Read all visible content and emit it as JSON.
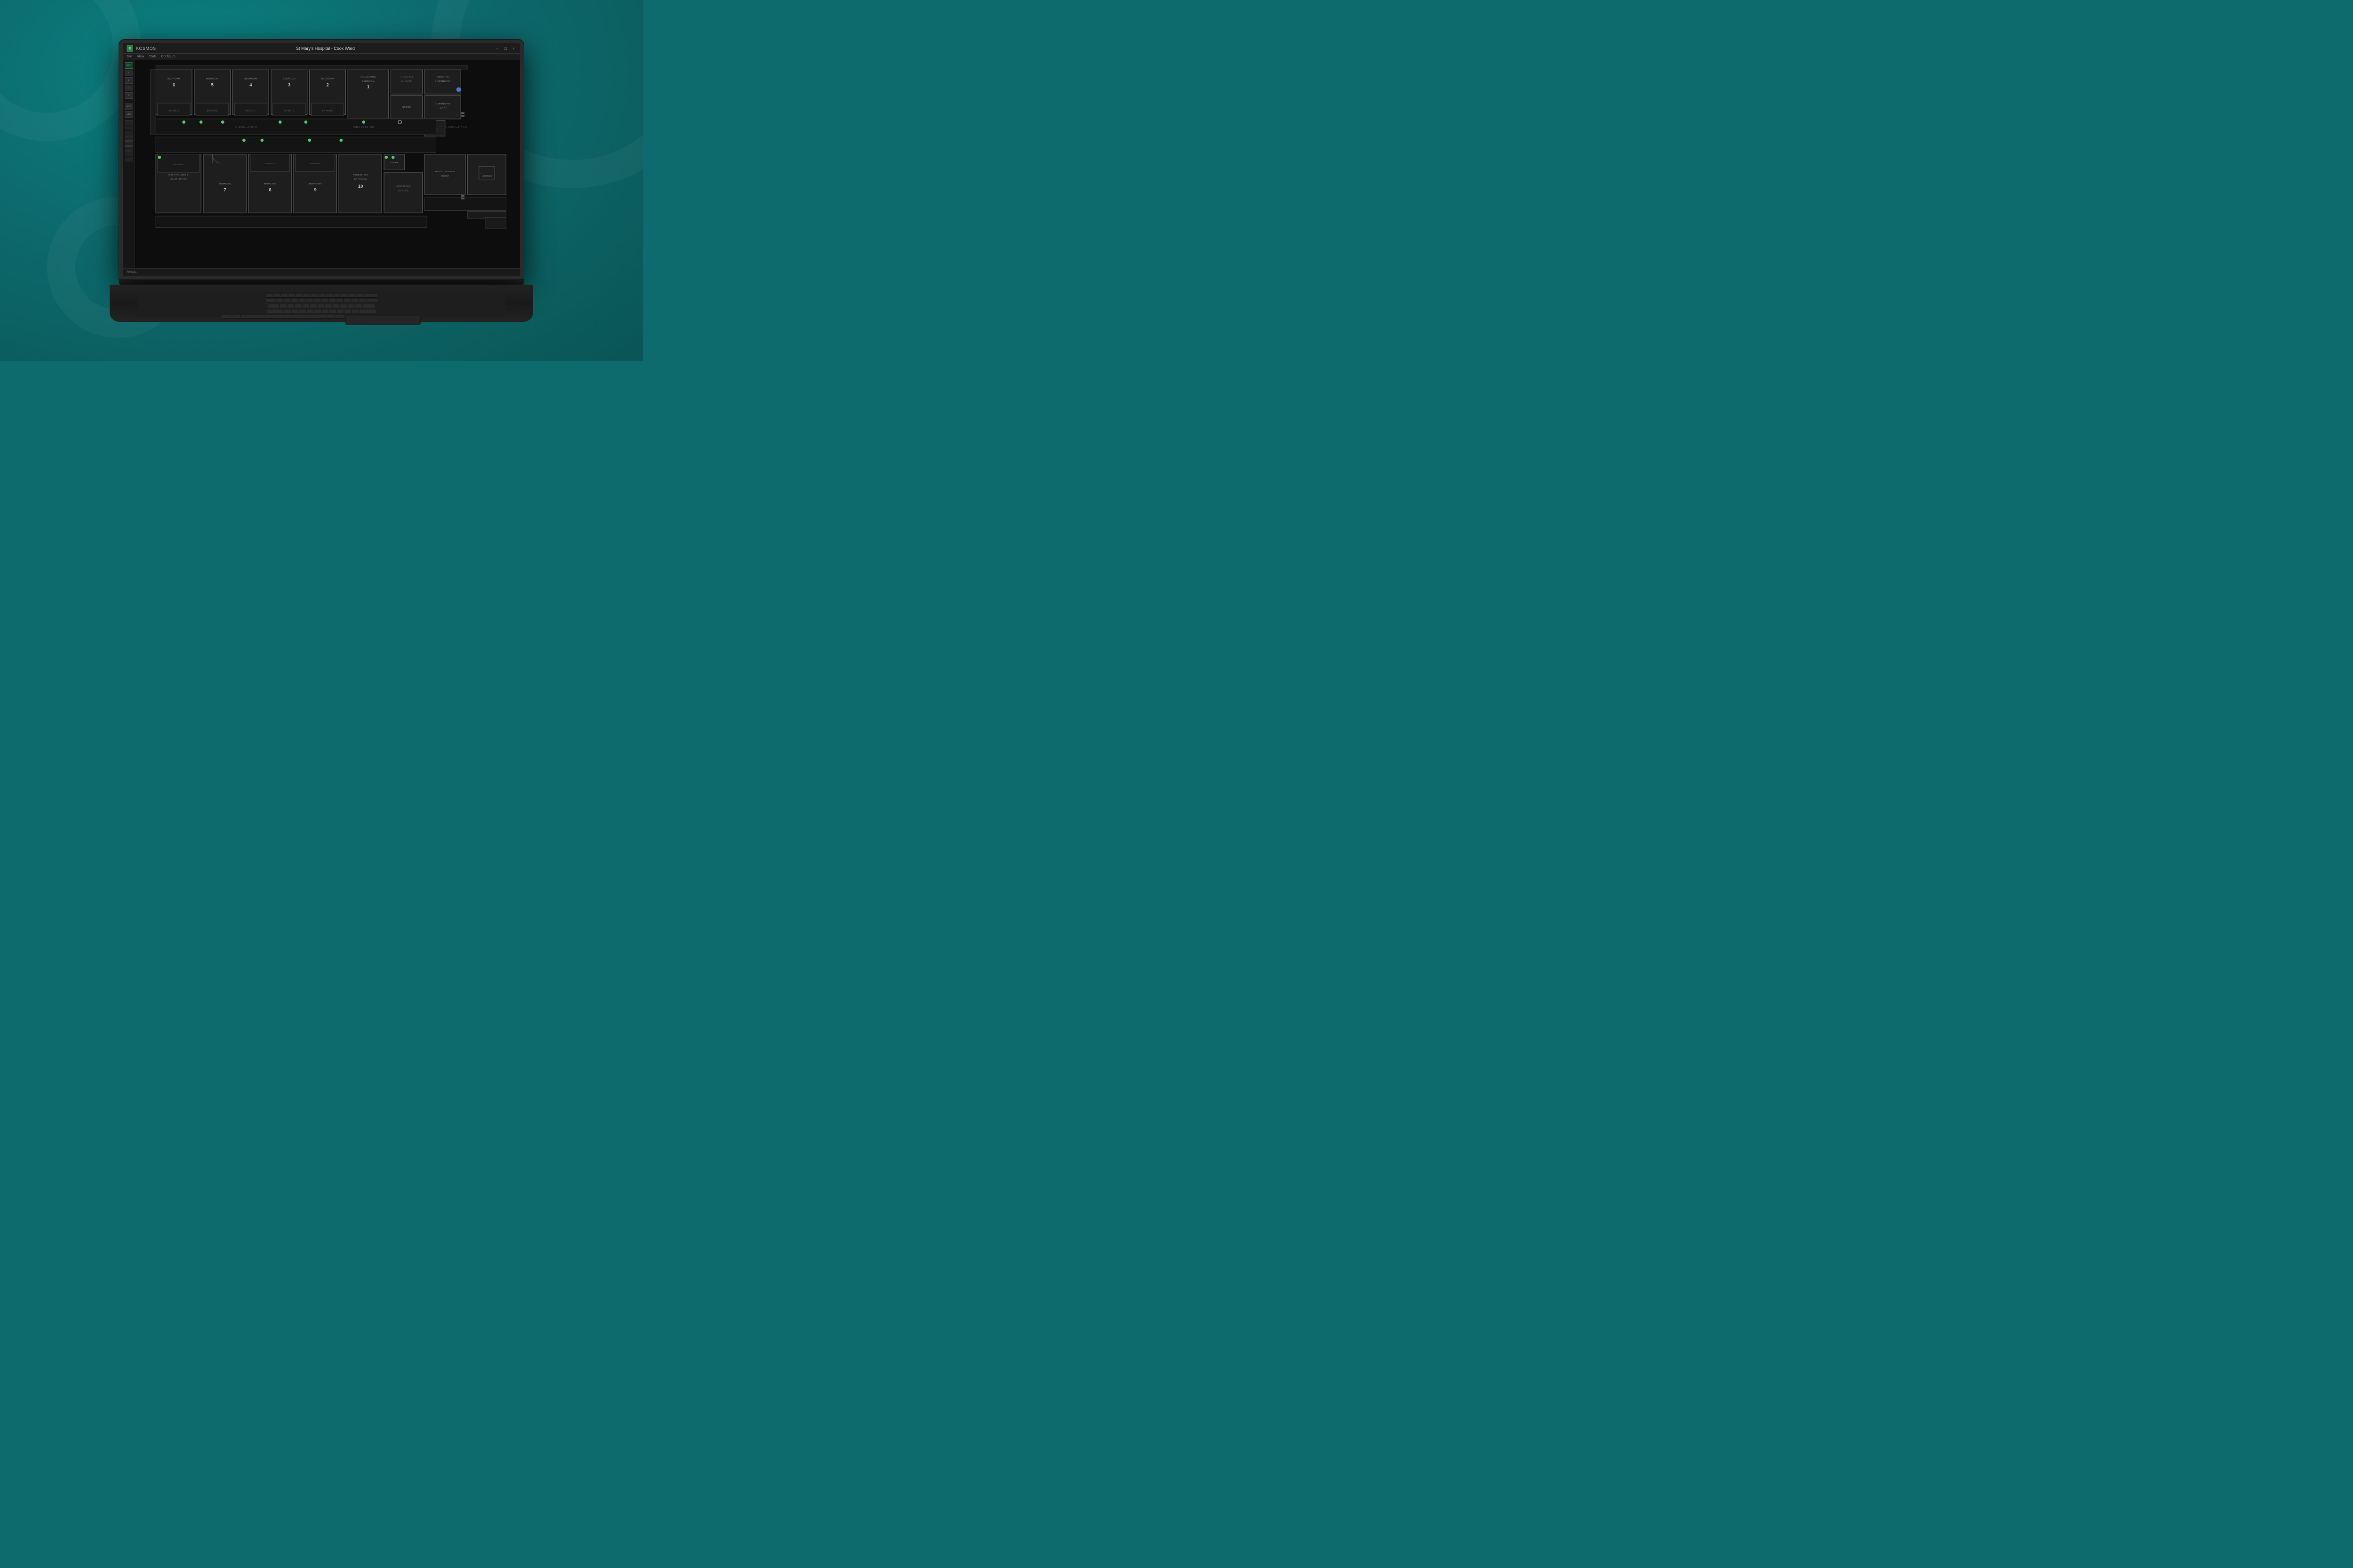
{
  "app": {
    "title": "KOSMOS",
    "window_title": "St Mary's Hospital - Cook Ward",
    "menu_items": [
      "Site",
      "View",
      "Tools",
      "Configure"
    ],
    "title_controls": [
      "−",
      "□",
      "×"
    ]
  },
  "sidebar": {
    "buttons": [
      "RST",
      "1",
      "2",
      "3",
      "4",
      "ACT",
      "SYS"
    ]
  },
  "status_bar": {
    "text": "Ready."
  },
  "floorplan": {
    "title": "St Mary's Hospital - Cook Ward",
    "rooms_upper": [
      {
        "id": "bedroom6",
        "label": "BEDROOM",
        "number": "6"
      },
      {
        "id": "bedroom5",
        "label": "BEDROOM",
        "number": "5"
      },
      {
        "id": "bedroom4",
        "label": "BEDROOM",
        "number": "4"
      },
      {
        "id": "bedroom3",
        "label": "BEDROOM",
        "number": "3"
      },
      {
        "id": "bedroom2",
        "label": "BEDROOM",
        "number": "2"
      },
      {
        "id": "accessible_bedroom1",
        "label": "ACCESSIBLE BEDROOM",
        "number": "1"
      },
      {
        "id": "accessible_ensuite",
        "label": "ACCESSIBLE EN-SUITE",
        "number": ""
      },
      {
        "id": "medicine_dispensary",
        "label": "MEDICINE DISPENSARY",
        "number": ""
      },
      {
        "id": "store",
        "label": "STORE",
        "number": ""
      },
      {
        "id": "dispensary_lobby",
        "label": "DISPENSARY LOBBY",
        "number": ""
      },
      {
        "id": "elec",
        "label": "ELEC",
        "number": ""
      }
    ],
    "rooms_lower": [
      {
        "id": "walking_aids",
        "label": "WALKING AIDS & HOIST STORE",
        "number": ""
      },
      {
        "id": "bedroom7",
        "label": "BEDROOM",
        "number": "7"
      },
      {
        "id": "bedroom8",
        "label": "BEDROOM",
        "number": "8"
      },
      {
        "id": "bedroom9",
        "label": "BEDROOM",
        "number": "9"
      },
      {
        "id": "accessible_bedroom10",
        "label": "ACCESSIBLE BEDROOM",
        "number": "10"
      },
      {
        "id": "accessible_ensuite_lower",
        "label": "ACCESSIBLE EN-SUITE",
        "number": ""
      },
      {
        "id": "de_escalation",
        "label": "DE-ESCALATION ROOM",
        "number": ""
      },
      {
        "id": "lounge",
        "label": "LOUNGE",
        "number": ""
      },
      {
        "id": "store_lower",
        "label": "STORE",
        "number": ""
      }
    ],
    "circulation_labels": [
      "CIRCULATION",
      "CIRCULATION",
      "CIRCULATION"
    ],
    "en_suite_labels": [
      "EN-SUITE",
      "EN-SUITE",
      "EN-SUITE",
      "EN-SUITE",
      "EN-SUITE",
      "EN-SUITE",
      "EN-SUITE",
      "EN-SUITE"
    ]
  }
}
